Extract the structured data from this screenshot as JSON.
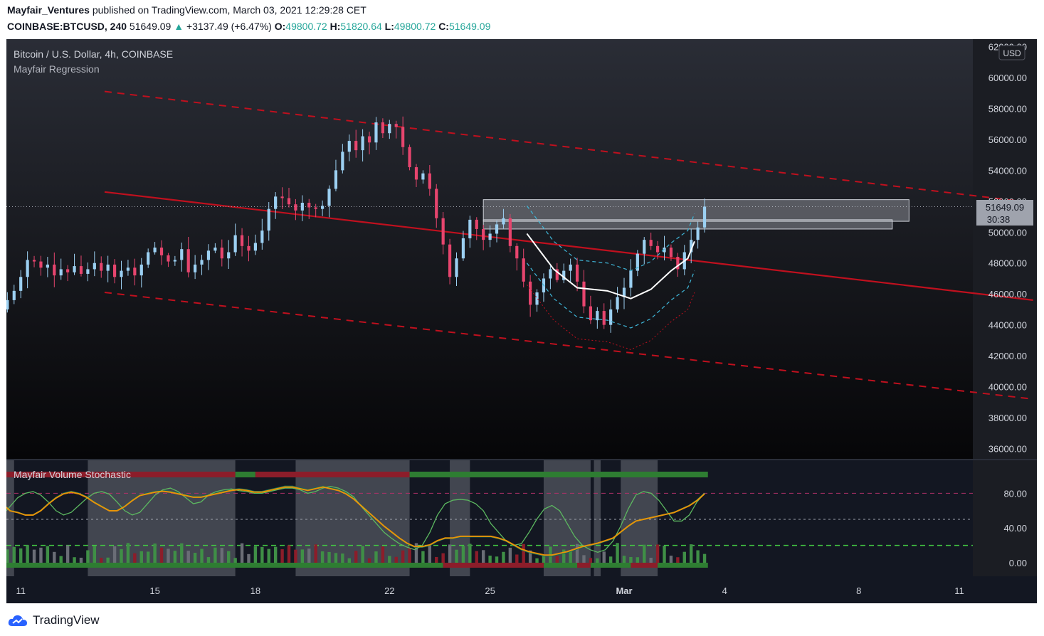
{
  "header": {
    "author": "Mayfair_Ventures",
    "published": "published on TradingView.com, March 03, 2021 12:29:28 CET",
    "symbol": "COINBASE:BTCUSD, 240",
    "last": "51649.09",
    "change": "+3137.49 (+6.47%)",
    "o_label": "O:",
    "o": "49800.72",
    "h_label": "H:",
    "h": "51820.64",
    "l_label": "L:",
    "l": "49800.72",
    "c_label": "C:",
    "c": "51649.09"
  },
  "legend": {
    "symbol_line": "Bitcoin / U.S. Dollar, 4h, COINBASE",
    "indicator": "Mayfair Regression",
    "lower_indicator": "Mayfair Volume Stochastic"
  },
  "price_axis": {
    "currency": "USD",
    "ticks": [
      "62000.00",
      "60000.00",
      "58000.00",
      "56000.00",
      "54000.00",
      "52000.00",
      "50000.00",
      "48000.00",
      "46000.00",
      "44000.00",
      "42000.00",
      "40000.00",
      "38000.00",
      "36000.00"
    ],
    "last_label": "51649.09",
    "countdown": "30:38"
  },
  "osc_axis": {
    "ticks": [
      "80.00",
      "40.00",
      "0.00"
    ]
  },
  "time_axis": {
    "ticks": [
      "11",
      "15",
      "18",
      "22",
      "25",
      "Mar",
      "4",
      "8",
      "11"
    ]
  },
  "footer": {
    "brand": "TradingView"
  },
  "colors": {
    "bg": "#131722",
    "up": "#9cd0f2",
    "down": "#e7456e",
    "regression": "#c0101e",
    "stoch_fast": "#ff9800",
    "stoch_slow": "#0f6e57"
  },
  "chart_data": [
    {
      "type": "candlestick",
      "title": "Bitcoin / U.S. Dollar, 4h, COINBASE",
      "timeframe": "4h",
      "ylim": [
        35000,
        62000
      ],
      "x_range": [
        "Feb 10 2021",
        "Mar 11 2021"
      ],
      "regression_channel": {
        "mid": [
          [
            13.5,
            52600
          ],
          [
            41.2,
            45600
          ]
        ],
        "upper": [
          [
            13.5,
            59100
          ],
          [
            41.2,
            51900
          ]
        ],
        "lower": [
          [
            13.5,
            46100
          ],
          [
            41.2,
            39200
          ]
        ]
      },
      "resistance_zones": [
        [
          50700,
          52100
        ],
        [
          50200,
          50800
        ]
      ],
      "last_price": 51649.09,
      "close_path": [
        [
          10.0,
          44700
        ],
        [
          10.2,
          45300
        ],
        [
          10.4,
          45000
        ],
        [
          10.6,
          45600
        ],
        [
          10.8,
          46200
        ],
        [
          11.0,
          47100
        ],
        [
          11.2,
          48200
        ],
        [
          11.4,
          48100
        ],
        [
          11.6,
          47700
        ],
        [
          11.8,
          47900
        ],
        [
          12.0,
          47200
        ],
        [
          12.2,
          47600
        ],
        [
          12.4,
          47400
        ],
        [
          12.6,
          47800
        ],
        [
          12.8,
          47300
        ],
        [
          13.0,
          47600
        ],
        [
          13.2,
          48000
        ],
        [
          13.4,
          47500
        ],
        [
          13.6,
          47900
        ],
        [
          13.8,
          47100
        ],
        [
          14.0,
          47500
        ],
        [
          14.2,
          47700
        ],
        [
          14.4,
          47200
        ],
        [
          14.6,
          47900
        ],
        [
          14.8,
          48700
        ],
        [
          15.0,
          49000
        ],
        [
          15.2,
          48500
        ],
        [
          15.4,
          48100
        ],
        [
          15.6,
          48200
        ],
        [
          15.8,
          48900
        ],
        [
          16.0,
          47400
        ],
        [
          16.2,
          47900
        ],
        [
          16.4,
          48200
        ],
        [
          16.6,
          48800
        ],
        [
          16.8,
          49000
        ],
        [
          17.0,
          48300
        ],
        [
          17.2,
          48700
        ],
        [
          17.4,
          49800
        ],
        [
          17.6,
          49100
        ],
        [
          17.8,
          48800
        ],
        [
          18.0,
          49300
        ],
        [
          18.2,
          50100
        ],
        [
          18.4,
          51500
        ],
        [
          18.6,
          52300
        ],
        [
          18.8,
          52200
        ],
        [
          19.0,
          51800
        ],
        [
          19.2,
          51400
        ],
        [
          19.4,
          51900
        ],
        [
          19.6,
          51600
        ],
        [
          19.8,
          51500
        ],
        [
          20.0,
          51700
        ],
        [
          20.2,
          52800
        ],
        [
          20.4,
          54000
        ],
        [
          20.6,
          55200
        ],
        [
          20.8,
          55900
        ],
        [
          21.0,
          55300
        ],
        [
          21.2,
          56200
        ],
        [
          21.4,
          55800
        ],
        [
          21.6,
          57100
        ],
        [
          21.8,
          56400
        ],
        [
          22.0,
          57000
        ],
        [
          22.2,
          56800
        ],
        [
          22.4,
          55500
        ],
        [
          22.6,
          54200
        ],
        [
          22.8,
          53400
        ],
        [
          23.0,
          53800
        ],
        [
          23.2,
          52800
        ],
        [
          23.4,
          50900
        ],
        [
          23.6,
          49200
        ],
        [
          23.8,
          47100
        ],
        [
          24.0,
          48300
        ],
        [
          24.2,
          49600
        ],
        [
          24.4,
          50800
        ],
        [
          24.6,
          50200
        ],
        [
          24.8,
          49500
        ],
        [
          25.0,
          49900
        ],
        [
          25.2,
          50500
        ],
        [
          25.4,
          50900
        ],
        [
          25.6,
          49100
        ],
        [
          25.8,
          48300
        ],
        [
          26.0,
          46800
        ],
        [
          26.2,
          45300
        ],
        [
          26.4,
          46100
        ],
        [
          26.6,
          47000
        ],
        [
          26.8,
          47600
        ],
        [
          27.0,
          46900
        ],
        [
          27.2,
          47500
        ],
        [
          27.4,
          47900
        ],
        [
          27.6,
          46800
        ],
        [
          27.8,
          45200
        ],
        [
          28.0,
          44300
        ],
        [
          28.2,
          44900
        ],
        [
          28.4,
          44000
        ],
        [
          28.6,
          45000
        ],
        [
          28.8,
          45800
        ],
        [
          29.0,
          46400
        ],
        [
          29.2,
          47500
        ],
        [
          29.4,
          48600
        ],
        [
          29.6,
          49500
        ],
        [
          29.8,
          49100
        ],
        [
          30.0,
          48700
        ],
        [
          30.2,
          49000
        ],
        [
          30.4,
          48400
        ],
        [
          30.6,
          47600
        ],
        [
          30.8,
          48700
        ],
        [
          31.0,
          49500
        ],
        [
          31.2,
          50300
        ],
        [
          31.4,
          51649
        ]
      ],
      "mayfair_regression_curve": [
        [
          26.1,
          49900
        ],
        [
          26.9,
          47600
        ],
        [
          27.6,
          46400
        ],
        [
          28.5,
          46200
        ],
        [
          29.2,
          45700
        ],
        [
          29.8,
          46300
        ],
        [
          30.4,
          47500
        ],
        [
          30.9,
          48300
        ],
        [
          31.1,
          49400
        ]
      ]
    },
    {
      "type": "line",
      "title": "Mayfair Volume Stochastic",
      "ylim": [
        -10,
        110
      ],
      "levels": {
        "overbought": 80,
        "middle": 50,
        "oversold": 20
      },
      "series": [
        {
          "name": "",
          "values_k": [
            45,
            48,
            55,
            65,
            75,
            80,
            82,
            78,
            70,
            60,
            55,
            58,
            66,
            74,
            80,
            82,
            79,
            70,
            60,
            55,
            58,
            68,
            78,
            84,
            86,
            82,
            75,
            68,
            70,
            78,
            82,
            84,
            85,
            83,
            82,
            80,
            80,
            82,
            84,
            86,
            86,
            84,
            80,
            82,
            86,
            88,
            86,
            82,
            76,
            65,
            55,
            45,
            35,
            28,
            22,
            18,
            15,
            20,
            35,
            55,
            68,
            72,
            73,
            72,
            68,
            60,
            45,
            35,
            25,
            20,
            22,
            35,
            50,
            62,
            66,
            60,
            45,
            30,
            20,
            15,
            12,
            15,
            25,
            42,
            62,
            78,
            82,
            80,
            72,
            60,
            48,
            48,
            55,
            70,
            80
          ]
        },
        {
          "name": "",
          "values_d": [
            70,
            70,
            68,
            60,
            58,
            55,
            55,
            60,
            68,
            75,
            80,
            82,
            80,
            76,
            70,
            65,
            60,
            60,
            65,
            72,
            78,
            80,
            82,
            83,
            82,
            80,
            78,
            76,
            76,
            78,
            80,
            82,
            84,
            85,
            84,
            82,
            82,
            84,
            86,
            88,
            88,
            86,
            84,
            86,
            88,
            86,
            84,
            80,
            74,
            66,
            58,
            50,
            42,
            35,
            28,
            22,
            18,
            18,
            20,
            25,
            28,
            28,
            30,
            30,
            30,
            30,
            30,
            28,
            25,
            20,
            15,
            12,
            10,
            8,
            8,
            10,
            12,
            15,
            18,
            20,
            22,
            25,
            28,
            35,
            42,
            48,
            50,
            52,
            54,
            56,
            58,
            62,
            66,
            72,
            80
          ]
        }
      ],
      "volume_histogram": true
    }
  ]
}
